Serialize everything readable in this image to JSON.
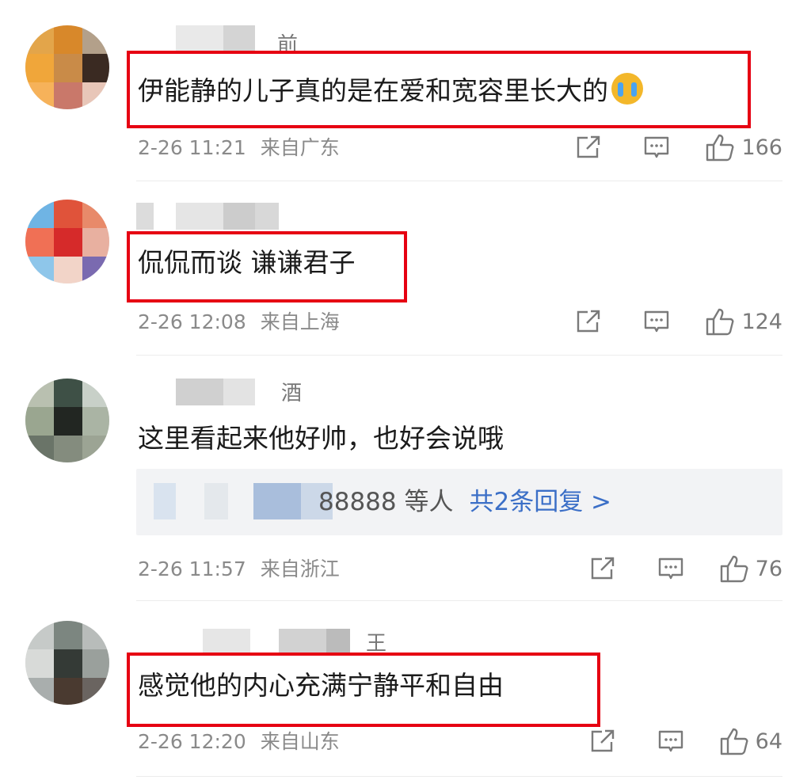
{
  "comments": [
    {
      "name_tail": "前",
      "content": "伊能静的儿子真的是在爱和宽容里长大的",
      "emoji": "crying-face",
      "time": "2-26 11:21",
      "location": "来自广东",
      "likes": "166",
      "highlighted": true
    },
    {
      "name_tail": "",
      "content": "侃侃而谈 谦谦君子",
      "time": "2-26 12:08",
      "location": "来自上海",
      "likes": "124",
      "highlighted": true
    },
    {
      "name_tail": "酒",
      "content": "这里看起来他好帅，也好会说哦",
      "replies": {
        "users": "88888 等人",
        "more": "共2条回复 >"
      },
      "time": "2-26 11:57",
      "location": "来自浙江",
      "likes": "76",
      "highlighted": false
    },
    {
      "name_tail": "王",
      "content": "感觉他的内心充满宁静平和自由",
      "time": "2-26 12:20",
      "location": "来自山东",
      "likes": "64",
      "highlighted": true
    }
  ],
  "colors": {
    "highlight_border": "#e60012",
    "reply_link": "#3b6fc7",
    "meta_text": "#8a8a8a"
  }
}
